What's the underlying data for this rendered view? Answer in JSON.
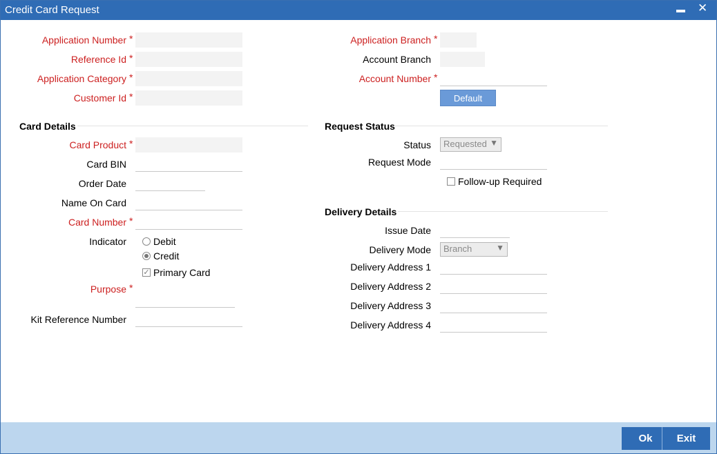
{
  "window": {
    "title": "Credit Card Request",
    "minimize_glyph": "▬",
    "close_glyph": "✕"
  },
  "header_fields": {
    "application_number": {
      "label": "Application Number",
      "value": ""
    },
    "reference_id": {
      "label": "Reference Id",
      "value": ""
    },
    "application_category": {
      "label": "Application Category",
      "value": ""
    },
    "customer_id": {
      "label": "Customer Id",
      "value": ""
    },
    "application_branch": {
      "label": "Application Branch",
      "value": ""
    },
    "account_branch": {
      "label": "Account Branch",
      "value": ""
    },
    "account_number": {
      "label": "Account Number",
      "value": ""
    },
    "default_button": "Default",
    "required_marker": "*"
  },
  "card_details": {
    "section_title": "Card Details",
    "card_product": {
      "label": "Card Product",
      "value": ""
    },
    "card_bin": {
      "label": "Card BIN",
      "value": ""
    },
    "order_date": {
      "label": "Order Date",
      "value": ""
    },
    "name_on_card": {
      "label": "Name On Card",
      "value": ""
    },
    "card_number": {
      "label": "Card Number",
      "value": ""
    },
    "indicator": {
      "label": "Indicator",
      "options": [
        "Debit",
        "Credit"
      ],
      "selected": "Credit"
    },
    "primary_card": {
      "label": "Primary Card",
      "checked": true
    },
    "purpose": {
      "label": "Purpose",
      "value": ""
    },
    "kit_reference_number": {
      "label": "Kit Reference Number",
      "value": ""
    }
  },
  "request_status": {
    "section_title": "Request Status",
    "status": {
      "label": "Status",
      "value": "Requested"
    },
    "request_mode": {
      "label": "Request Mode",
      "value": ""
    },
    "follow_up": {
      "label": "Follow-up Required",
      "checked": false
    }
  },
  "delivery_details": {
    "section_title": "Delivery Details",
    "issue_date": {
      "label": "Issue Date",
      "value": ""
    },
    "delivery_mode": {
      "label": "Delivery Mode",
      "value": "Branch"
    },
    "address_1": {
      "label": "Delivery Address 1",
      "value": ""
    },
    "address_2": {
      "label": "Delivery Address 2",
      "value": ""
    },
    "address_3": {
      "label": "Delivery Address 3",
      "value": ""
    },
    "address_4": {
      "label": "Delivery Address 4",
      "value": ""
    }
  },
  "footer": {
    "ok_label": "Ok",
    "exit_label": "Exit"
  },
  "colors": {
    "title_bar": "#2f6cb5",
    "required_label": "#cc1f1f",
    "footer_bg": "#bcd6ee",
    "button": "#2f6cb5"
  }
}
